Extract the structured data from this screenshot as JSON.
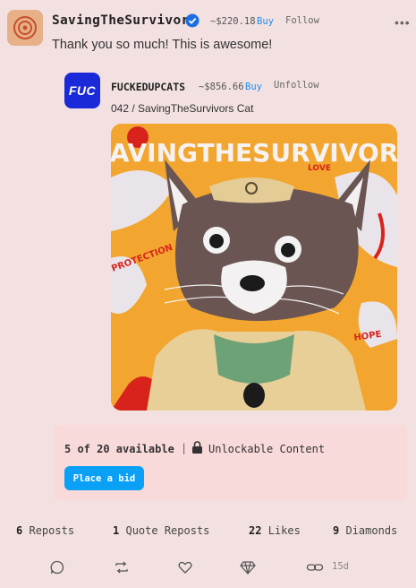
{
  "post": {
    "username": "SavingTheSurvivors",
    "price": "~$220.18",
    "buy_label": "Buy",
    "follow_label": "Follow",
    "more_label": "•••",
    "text": "Thank you so much! This is awesome!"
  },
  "quote": {
    "avatar_text": "FUC",
    "username": "FUCKEDUPCATS",
    "price": "~$856.66",
    "buy_label": "Buy",
    "unfollow_label": "Unfollow",
    "title": "042 / SavingTheSurvivors Cat",
    "image_words": [
      "SAVINGTHESURVIVORS",
      "LOVE",
      "PROTECTION",
      "HOPE"
    ]
  },
  "availability": {
    "available_text": "5 of 20 available",
    "separator": "|",
    "unlockable_text": "Unlockable Content",
    "bid_label": "Place a bid"
  },
  "stats": {
    "reposts": {
      "count": "6",
      "label": "Reposts"
    },
    "quote_reposts": {
      "count": "1",
      "label": "Quote Reposts"
    },
    "likes": {
      "count": "22",
      "label": "Likes"
    },
    "diamonds": {
      "count": "9",
      "label": "Diamonds"
    }
  },
  "actions": {
    "time": "15d",
    "icons": [
      "comment-icon",
      "repost-icon",
      "heart-icon",
      "diamond-icon",
      "link-icon"
    ]
  },
  "colors": {
    "background": "#f3e1e1",
    "accent_blue": "#0aa0f5",
    "avail_box": "#f9dada",
    "quote_avatar": "#1a2ad8"
  }
}
